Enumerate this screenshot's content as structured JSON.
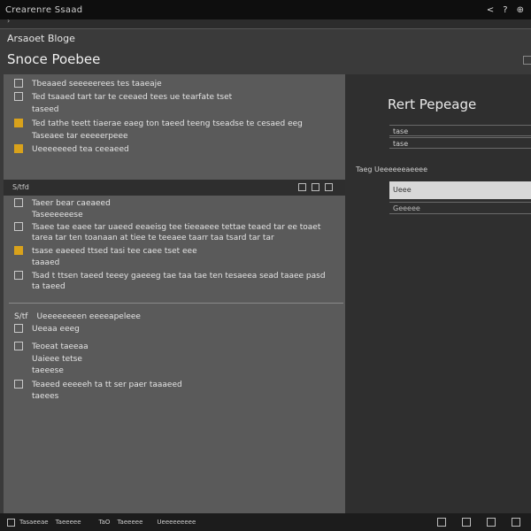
{
  "window": {
    "title": "Crearenre Ssaad",
    "controls": [
      "<",
      "?",
      "⊕"
    ]
  },
  "strip_label": "›",
  "breadcrumb": "Arsaoet Bloge",
  "page_title": "Snoce Poebee",
  "left_sections": {
    "section1": [
      {
        "icon": "square-icon",
        "style": "outline",
        "text": "Tbeaaed seeeeerees tes taaeaje"
      },
      {
        "icon": "square-icon",
        "style": "outline",
        "text": "Ted tsaaed tart tar te ceeaed tees ue tearfate tset"
      },
      {
        "icon": "none",
        "style": "none",
        "text": "taseed"
      },
      {
        "icon": "gold-box-icon",
        "style": "gold",
        "text": "Ted tathe teett tiaerae eaeg ton taeed teeng tseadse te cesaed eeg"
      },
      {
        "icon": "none",
        "style": "none",
        "text": "Taseaee tar eeeeerpeee"
      },
      {
        "icon": "gold-box-icon",
        "style": "gold",
        "text": "Ueeeeeeed tea ceeaeed"
      }
    ],
    "bar_label": "S/tfd",
    "section2": [
      {
        "icon": "square-icon",
        "style": "outline",
        "text": "Taeer bear caeaeed"
      },
      {
        "icon": "none",
        "style": "none",
        "text": "Taseeeeeese"
      },
      {
        "icon": "warning-icon",
        "style": "outline",
        "text": "Tsaee tae eaee tar uaeed eeaeisg tee tieeaeee tettae teaed tar ee toaet tarea tar ten toanaan at tiee te teeaee taarr taa tsard tar tar"
      },
      {
        "icon": "gold-box-icon",
        "style": "gold",
        "text": "tsase eaeeed ttsed tasi tee caee tset eee"
      },
      {
        "icon": "none",
        "style": "none",
        "text": "taaaed"
      },
      {
        "icon": "pencil-icon",
        "style": "outline",
        "text": "Tsad t ttsen taeed teeey gaeeeg tae taa tae ten tesaeea sead taaee pasd ta taeed"
      }
    ],
    "section3_header": "Ueeeeeeeen eeeeapeleee",
    "section3_header_prefix": "S/tf",
    "section3": [
      {
        "icon": "square-icon",
        "style": "outline",
        "text": "Ueeaa eeeg"
      },
      {
        "icon": "square-icon",
        "style": "outline",
        "text": "Teoeat taeeaa"
      },
      {
        "icon": "none",
        "style": "none",
        "text": "Uaieee tetse"
      },
      {
        "icon": "none",
        "style": "none",
        "text": "taeeese"
      },
      {
        "icon": "square-icon",
        "style": "outline",
        "text": "Teaeed eeeeeh ta tt ser paer taaaeed"
      },
      {
        "icon": "none",
        "style": "none",
        "text": "taeees"
      }
    ]
  },
  "right_panel": {
    "title": "Rert Pepeage",
    "field1": "tase",
    "field2": "tase",
    "field_label": "Taeg  Ueeeeeeaeeee",
    "field_selected": "Ueee",
    "field_last": "Geeeee"
  },
  "bottom_bar": {
    "items": [
      "Tasaeeae",
      "Taeeeee",
      "TaO",
      "Taeeeee",
      "Ueeeeeeeee"
    ],
    "right_icons": [
      "image-icon",
      "image-icon",
      "link-icon",
      "image-icon"
    ]
  }
}
